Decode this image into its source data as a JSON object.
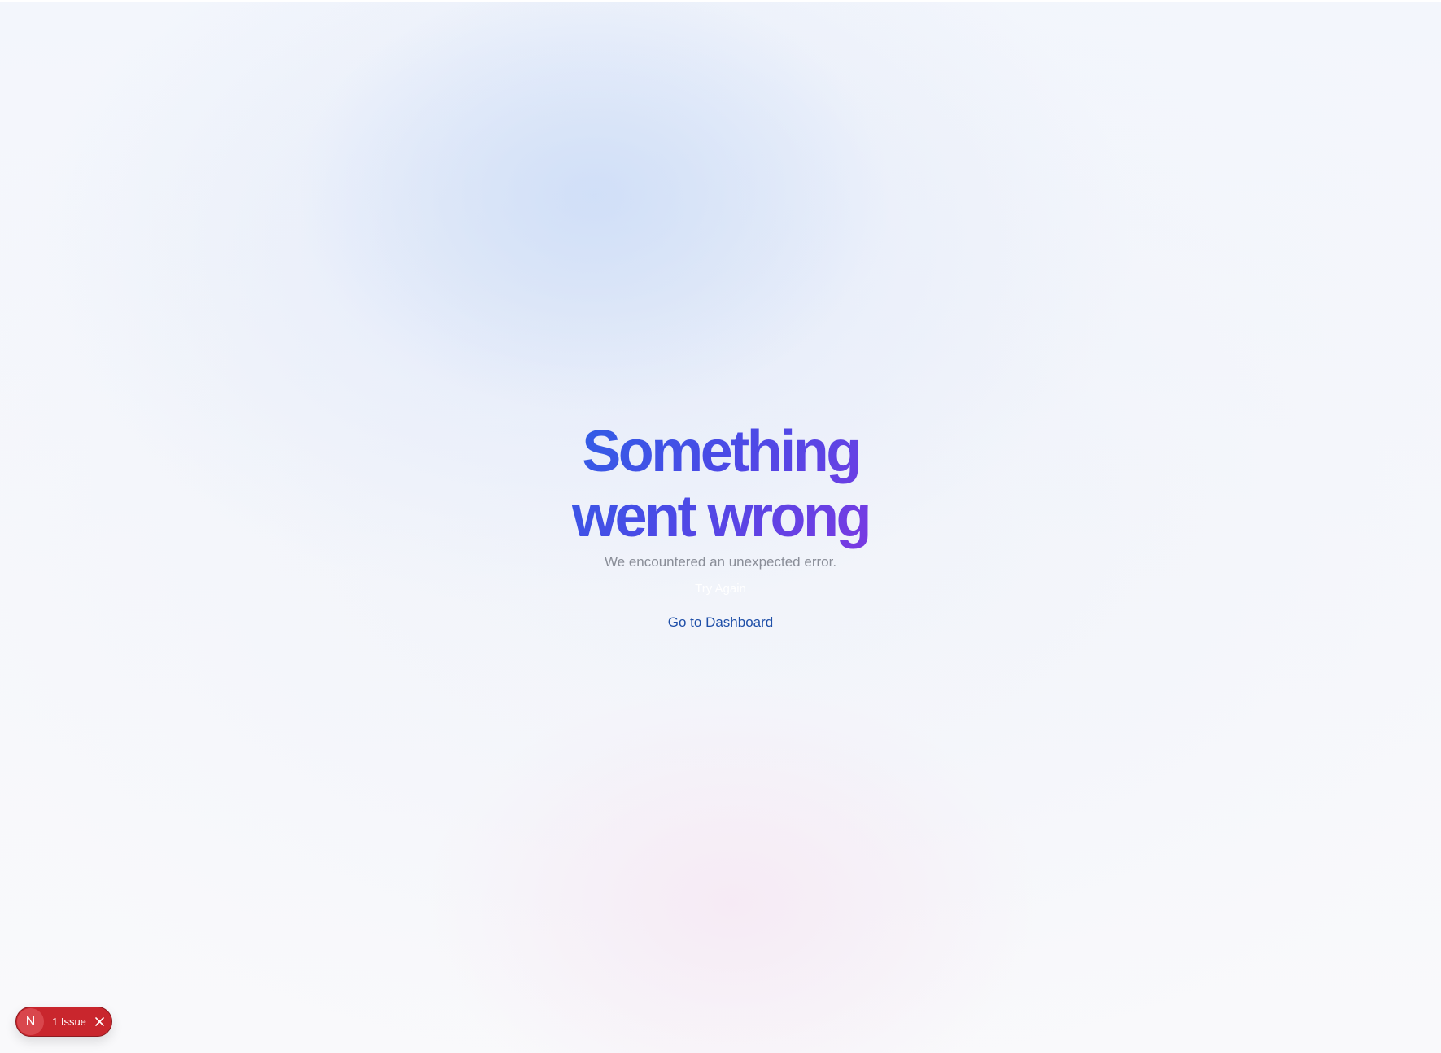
{
  "page": {
    "headline_line1": "Something",
    "headline_line2": "went wrong",
    "subtitle": "We encountered an unexpected error.",
    "try_again_label": "Try Again",
    "dashboard_link_label": "Go to Dashboard"
  },
  "dev_indicator": {
    "logo_letter": "N",
    "issues_label": "1 Issue",
    "close_icon": "close-icon"
  },
  "colors": {
    "headline_gradient_start": "#2f5fe6",
    "headline_gradient_end": "#7a3ae2",
    "subtitle": "#8a8e98",
    "link": "#1f4fa8",
    "issue_pill": "#c9262d"
  }
}
